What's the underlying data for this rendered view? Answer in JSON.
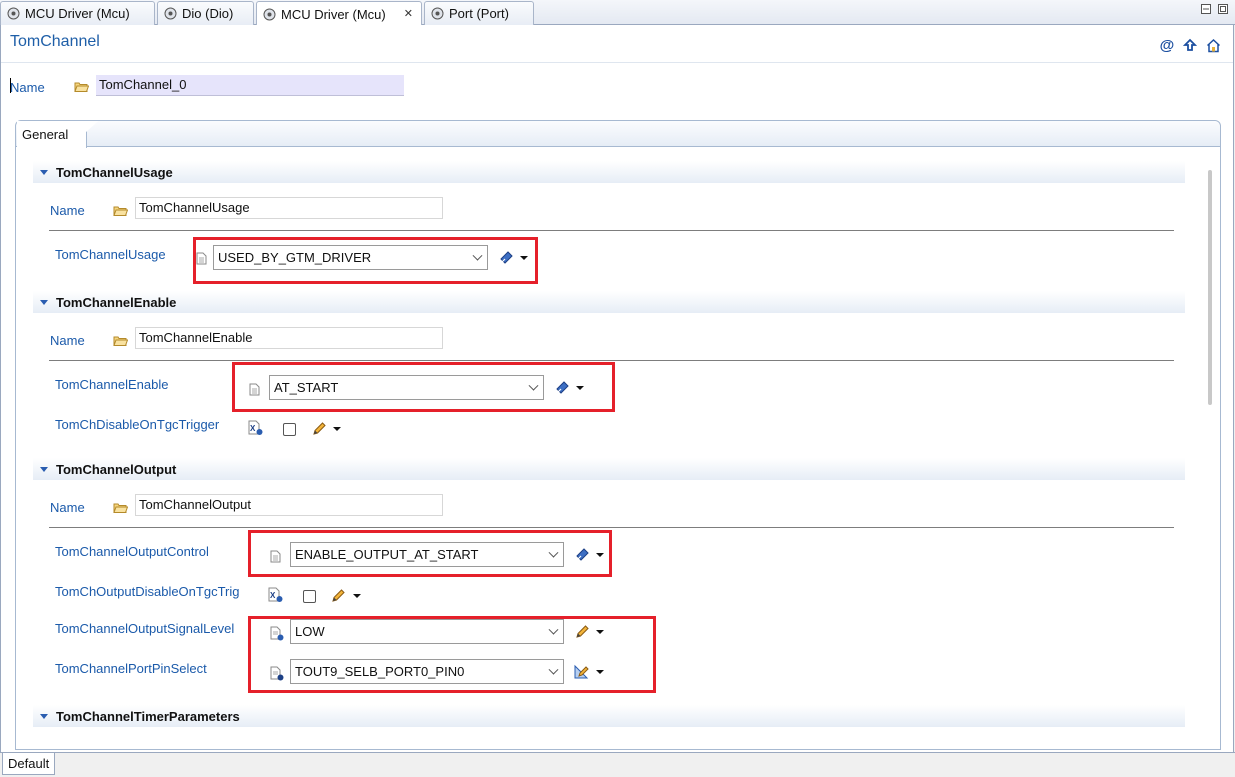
{
  "tabs": [
    {
      "label": "MCU Driver (Mcu)",
      "active": false
    },
    {
      "label": "Dio (Dio)",
      "active": false
    },
    {
      "label": "MCU Driver (Mcu)",
      "active": true,
      "close": "✕"
    },
    {
      "label": "Port (Port)",
      "active": false
    }
  ],
  "editor": {
    "title": "TomChannel",
    "header_icons": [
      "at-sign-icon",
      "up-arrow-icon",
      "home-icon"
    ],
    "name_label": "Name",
    "name_value": "TomChannel_0",
    "general_tab": "General"
  },
  "sections": {
    "usage": {
      "title": "TomChannelUsage",
      "name_label": "Name",
      "name_value": "TomChannelUsage",
      "param_label": "TomChannelUsage",
      "param_value": "USED_BY_GTM_DRIVER"
    },
    "enable": {
      "title": "TomChannelEnable",
      "name_label": "Name",
      "name_value": "TomChannelEnable",
      "param_label": "TomChannelEnable",
      "param_value": "AT_START",
      "disable_label": "TomChDisableOnTgcTrigger"
    },
    "output": {
      "title": "TomChannelOutput",
      "name_label": "Name",
      "name_value": "TomChannelOutput",
      "control_label": "TomChannelOutputControl",
      "control_value": "ENABLE_OUTPUT_AT_START",
      "disable_label": "TomChOutputDisableOnTgcTrig",
      "signal_label": "TomChannelOutputSignalLevel",
      "signal_value": "LOW",
      "pin_label": "TomChannelPortPinSelect",
      "pin_value": "TOUT9_SELB_PORT0_PIN0"
    },
    "timer": {
      "title": "TomChannelTimerParameters"
    }
  },
  "bottom_tab": "Default",
  "colors": {
    "label_blue": "#1b5aaa",
    "highlight_red": "#e5202a",
    "name_field_bg": "#e6e4fb"
  }
}
